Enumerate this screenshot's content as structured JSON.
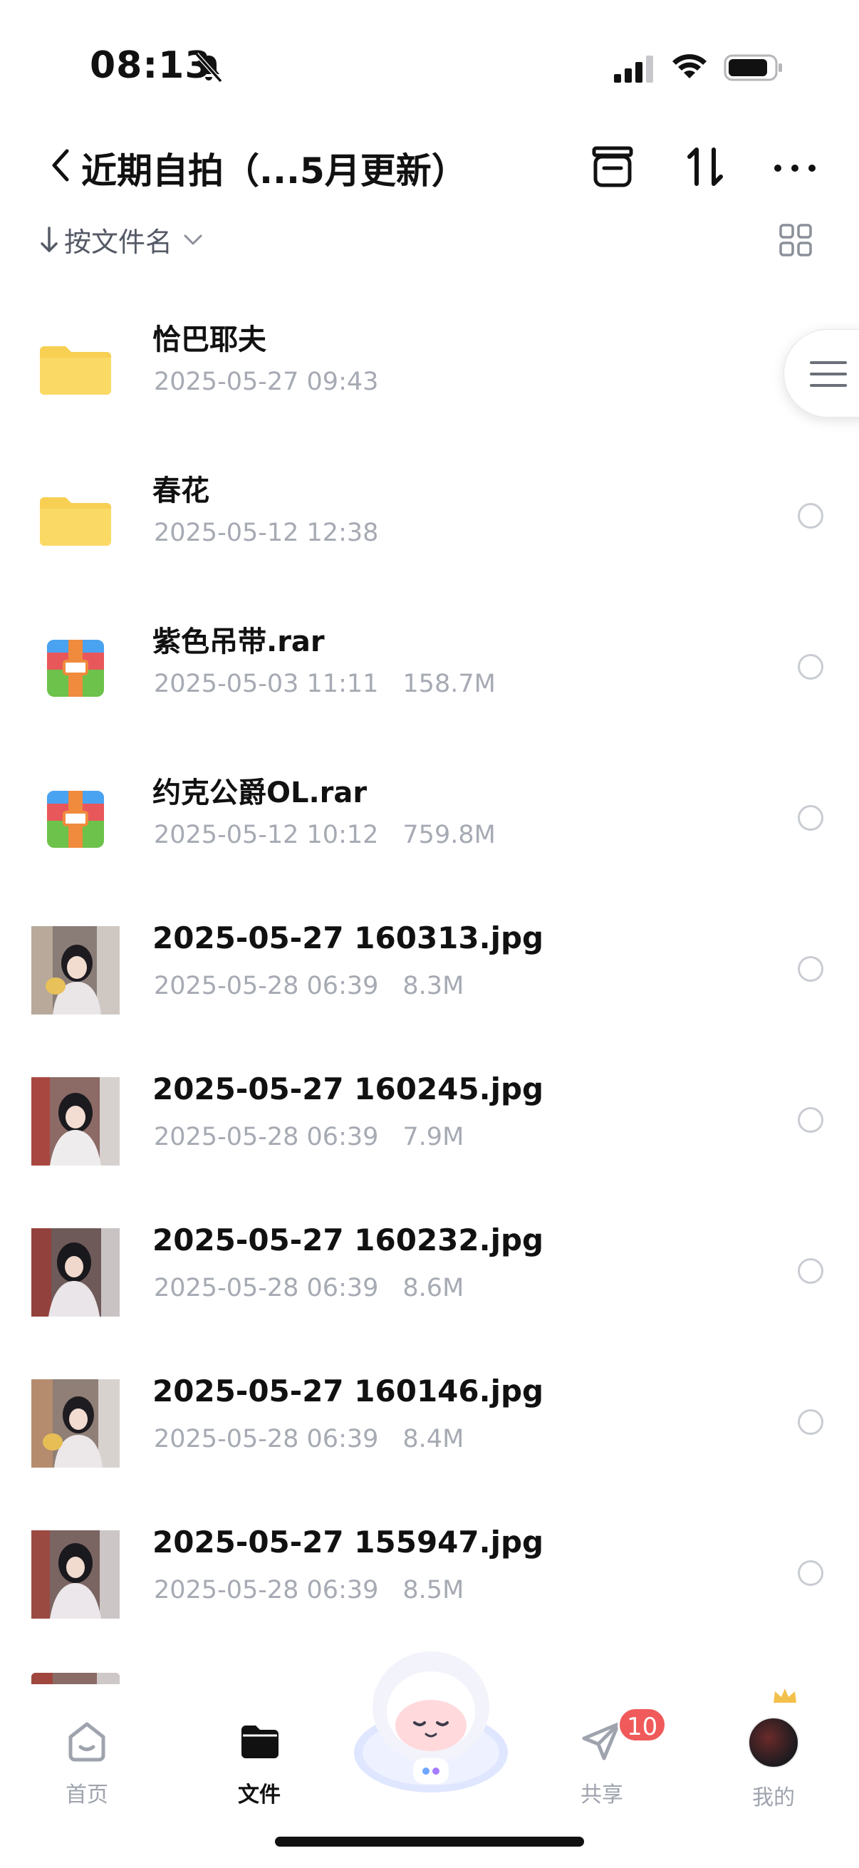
{
  "status_bar": {
    "time": "08:13"
  },
  "header": {
    "title": "近期自拍（...5月更新）"
  },
  "sort": {
    "label": "按文件名"
  },
  "files": [
    {
      "name": "恰巴耶夫",
      "date": "2025-05-27 09:43",
      "size": "",
      "type": "folder"
    },
    {
      "name": "春花",
      "date": "2025-05-12 12:38",
      "size": "",
      "type": "folder"
    },
    {
      "name": "紫色吊带.rar",
      "date": "2025-05-03 11:11",
      "size": "158.7M",
      "type": "archive"
    },
    {
      "name": "约克公爵OL.rar",
      "date": "2025-05-12 10:12",
      "size": "759.8M",
      "type": "archive"
    },
    {
      "name": "2025-05-27 160313.jpg",
      "date": "2025-05-28 06:39",
      "size": "8.3M",
      "type": "photo"
    },
    {
      "name": "2025-05-27 160245.jpg",
      "date": "2025-05-28 06:39",
      "size": "7.9M",
      "type": "photo"
    },
    {
      "name": "2025-05-27 160232.jpg",
      "date": "2025-05-28 06:39",
      "size": "8.6M",
      "type": "photo"
    },
    {
      "name": "2025-05-27 160146.jpg",
      "date": "2025-05-28 06:39",
      "size": "8.4M",
      "type": "photo"
    },
    {
      "name": "2025-05-27 155947.jpg",
      "date": "2025-05-28 06:39",
      "size": "8.5M",
      "type": "photo"
    }
  ],
  "bottom_nav": {
    "home": "首页",
    "files": "文件",
    "share": "共享",
    "share_badge": "10",
    "mine": "我的"
  },
  "colors": {
    "folder": "#f7cf52",
    "archive_green": "#6cc24a",
    "archive_orange": "#f08a3c",
    "archive_red": "#e8575a",
    "archive_blue": "#4aa3f0",
    "badge": "#f05a5a",
    "meta_text": "#a6aab3"
  }
}
